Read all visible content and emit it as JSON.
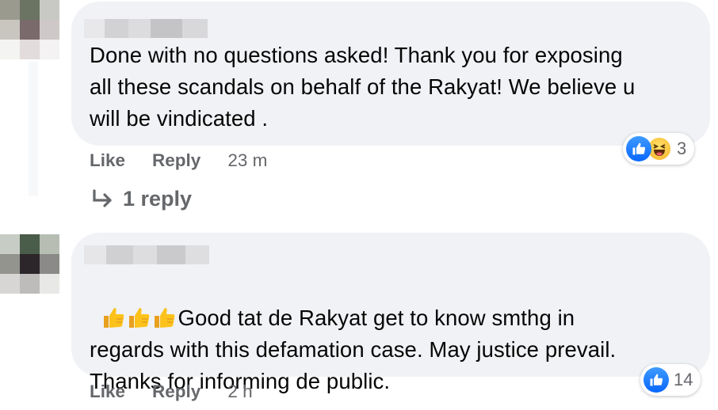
{
  "comments": [
    {
      "text": "Done with no questions asked! Thank you for exposing\nall these scandals on behalf of the Rakyat! We believe u\nwill be vindicated .",
      "like_label": "Like",
      "reply_label": "Reply",
      "time": "23 m",
      "reaction_count": "3",
      "reaction_icons": [
        "like-icon",
        "haha-icon"
      ],
      "replies_label": "1 reply"
    },
    {
      "emoji": [
        "thumbs-up-emoji",
        "thumbs-up-emoji",
        "thumbs-up-emoji"
      ],
      "text_line1": "Good tat de Rakyat get to know smthg in",
      "text_rest": "regards with this defamation case. May justice prevail.\nThanks for informing de public.",
      "like_label": "Like",
      "reply_label": "Reply",
      "time": "2 h",
      "reaction_count": "14",
      "reaction_icons": [
        "like-icon"
      ]
    }
  ],
  "colors": {
    "bubble": "#f0f2f5",
    "secondary_text": "#65676b",
    "like_blue": "#0866ff"
  }
}
